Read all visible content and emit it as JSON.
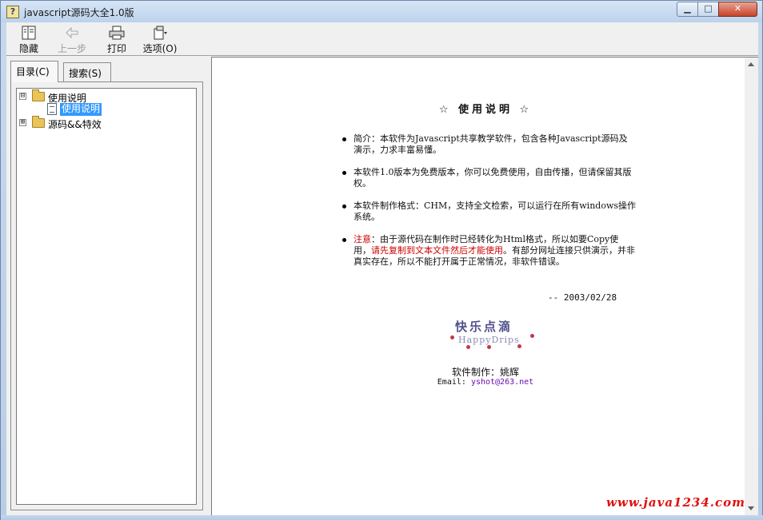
{
  "window": {
    "title": "javascript源码大全1.0版",
    "minimize_label": "▁",
    "maximize_label": "□",
    "close_label": "✕"
  },
  "toolbar": {
    "hide_label": "隐藏",
    "back_label": "上一步",
    "print_label": "打印",
    "options_label": "选项(O)"
  },
  "tabs": {
    "contents_label": "目录(C)",
    "search_label": "搜索(S)"
  },
  "tree": {
    "items": [
      {
        "label": "使用说明",
        "expander": "⊟",
        "expanded": true
      },
      {
        "label": "使用说明",
        "selected": true
      },
      {
        "label": "源码&&特效",
        "expander": "⊞",
        "expanded": false
      }
    ]
  },
  "doc": {
    "title": "☆ 使用说明 ☆",
    "bullets": [
      {
        "text": "简介：本软件为Javascript共享教学软件，包含各种Javascript源码及演示，力求丰富易懂。"
      },
      {
        "text": "本软件1.0版本为免费版本，你可以免费使用，自由传播，但请保留其版权。"
      },
      {
        "text": "本软件制作格式：CHM，支持全文检索，可以运行在所有windows操作系统。"
      },
      {
        "note_label": "注意",
        "text_a": "：由于源代码在制作时已经转化为Html格式，所以如要Copy使用，",
        "red_text": "请先复制到文本文件然后才能使用",
        "text_b": "。有部分网址连接只供演示，并非真实存在，所以不能打开属于正常情况，非软件错误。"
      }
    ],
    "date": "-- 2003/02/28",
    "logo_cn": "快乐点滴",
    "logo_en": "HappyDrips",
    "credit": "软件制作：姚辉",
    "email_label": "Email: ",
    "email": "yshot@263.net"
  },
  "watermark": "www.java1234.com",
  "colors": {
    "accent_red": "#cc0000",
    "selection": "#3399ff",
    "link": "#6a0dad",
    "watermark": "#e01010"
  }
}
